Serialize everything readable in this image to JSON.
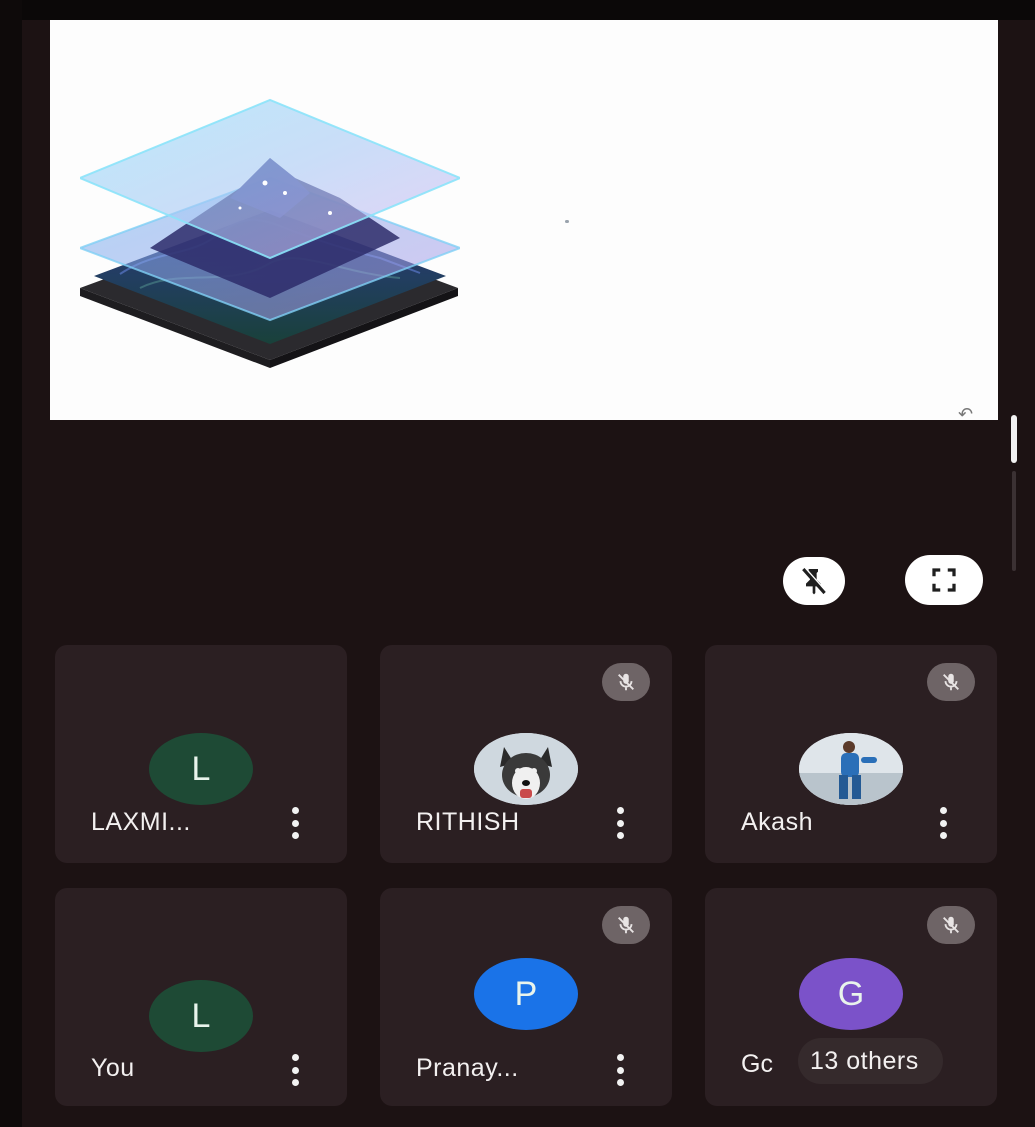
{
  "presentation": {
    "illustration": "layered-map-illustration"
  },
  "controls": {
    "pin_icon": "unpin-icon",
    "fullscreen_icon": "fullscreen-icon"
  },
  "colors": {
    "tile_bg": "#2b1f22",
    "avatar_green": "#1e4a35",
    "avatar_blue": "#1a73e8",
    "avatar_purple": "#7b52c9"
  },
  "participants": [
    {
      "name": "LAXMI...",
      "initial": "L",
      "avatar": "initial-green",
      "muted": false
    },
    {
      "name": "RITHISH",
      "initial": "",
      "avatar": "photo-husky",
      "muted": true
    },
    {
      "name": "Akash",
      "initial": "",
      "avatar": "photo-person",
      "muted": true
    },
    {
      "name": "You",
      "initial": "L",
      "avatar": "initial-green",
      "muted": false
    },
    {
      "name": "Pranay...",
      "initial": "P",
      "avatar": "initial-blue",
      "muted": true
    },
    {
      "name_prefix": "Gс",
      "initial": "G",
      "avatar": "initial-purple",
      "muted": true,
      "others_label": "13 others"
    }
  ]
}
